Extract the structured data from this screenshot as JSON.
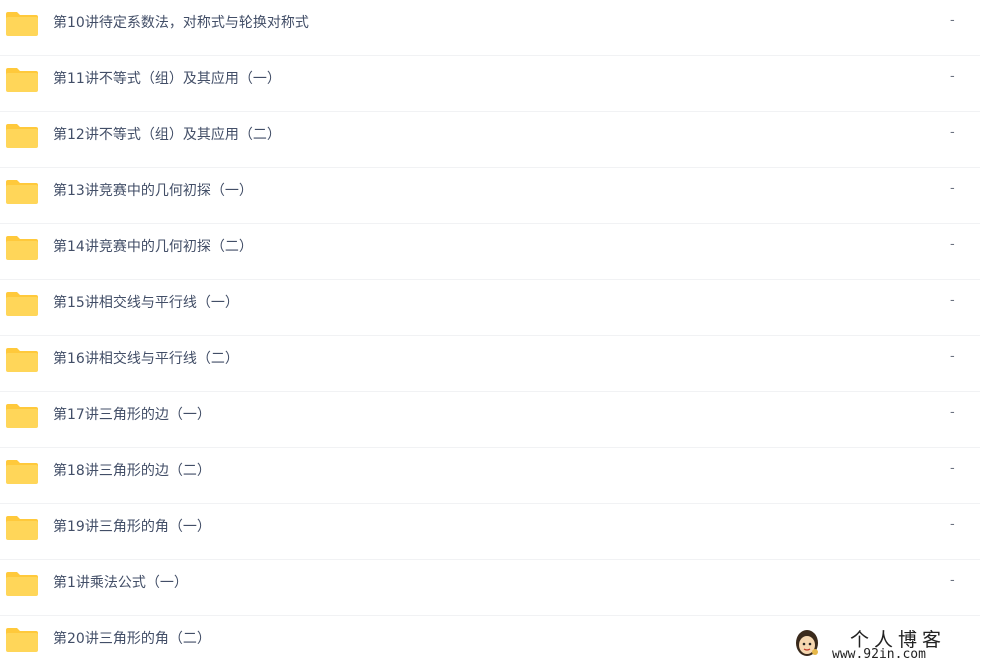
{
  "colors": {
    "folder_body": "#ffd659",
    "folder_tab": "#ffc93b",
    "text": "#424e67",
    "divider": "#f1f2f4"
  },
  "files": [
    {
      "icon": "folder-icon",
      "name": "第10讲待定系数法，对称式与轮换对称式",
      "size": "-"
    },
    {
      "icon": "folder-icon",
      "name": "第11讲不等式（组）及其应用（一）",
      "size": "-"
    },
    {
      "icon": "folder-icon",
      "name": "第12讲不等式（组）及其应用（二）",
      "size": "-"
    },
    {
      "icon": "folder-icon",
      "name": "第13讲竞赛中的几何初探（一）",
      "size": "-"
    },
    {
      "icon": "folder-icon",
      "name": "第14讲竞赛中的几何初探（二）",
      "size": "-"
    },
    {
      "icon": "folder-icon",
      "name": "第15讲相交线与平行线（一）",
      "size": "-"
    },
    {
      "icon": "folder-icon",
      "name": "第16讲相交线与平行线（二）",
      "size": "-"
    },
    {
      "icon": "folder-icon",
      "name": "第17讲三角形的边（一）",
      "size": "-"
    },
    {
      "icon": "folder-icon",
      "name": "第18讲三角形的边（二）",
      "size": "-"
    },
    {
      "icon": "folder-icon",
      "name": "第19讲三角形的角（一）",
      "size": "-"
    },
    {
      "icon": "folder-icon",
      "name": "第1讲乘法公式（一）",
      "size": "-"
    },
    {
      "icon": "folder-icon",
      "name": "第20讲三角形的角（二）",
      "size": ""
    }
  ],
  "watermark": {
    "title": "个人博客",
    "url": "www.92in.com"
  }
}
